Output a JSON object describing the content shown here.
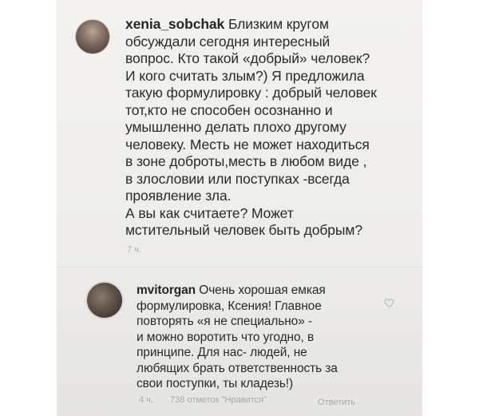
{
  "post": {
    "username": "xenia_sobchak",
    "caption_lines": [
      "Близким кругом",
      "обсуждали сегодня  интересный",
      "вопрос. Кто такой «добрый» человек?",
      "И кого считать злым?) Я предложила",
      "такую формулировку :  добрый человек",
      "тот,кто не способен осознанно и",
      "умышленно делать плохо другому",
      "человеку.  Месть не может находиться",
      "в зоне доброты,месть в любом виде ,",
      "в злословии или поступках -всегда",
      "проявление зла.",
      "А вы как считаете? Может",
      "мстительный человек быть добрым?"
    ],
    "time": "7 ч."
  },
  "comment": {
    "username": "mvitorgan",
    "text_lines": [
      "Очень хорошая емкая",
      "формулировка, Ксения! Главное",
      "повторять «я не специально» -",
      "и можно воротить что угодно, в",
      "принципе. Для нас- людей, не",
      "любящих брать ответственность за",
      "свои поступки, ты  кладезь!)"
    ],
    "time": "4 ч.",
    "likes": "738 отметок \"Нравится\"",
    "reply": "Ответить",
    "like_icon": "heart-icon"
  }
}
